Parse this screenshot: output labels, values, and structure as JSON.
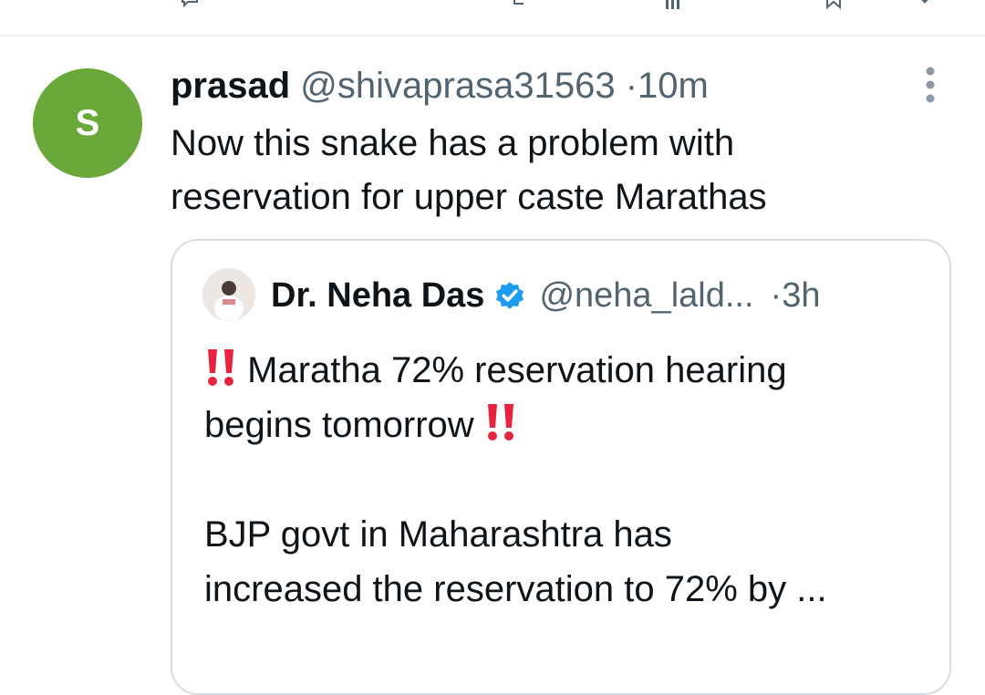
{
  "tweet": {
    "avatar_letter": "S",
    "avatar_color": "#6aa83a",
    "display_name": "prasad",
    "handle": "@shivaprasa31563",
    "separator": "·",
    "time": "10m",
    "text_line1": "Now this snake has a problem with",
    "text_line2": "reservation for upper caste Marathas"
  },
  "quote": {
    "display_name": "Dr. Neha Das",
    "handle": "@neha_lald...",
    "separator": "·",
    "time": "3h",
    "line1": "Maratha 72% reservation hearing",
    "line2": "begins tomorrow",
    "line3": "BJP govt in Maharashtra has",
    "line4": "increased the reservation to 72% by ..."
  },
  "icons": {
    "top": [
      "reply-icon",
      "retweet-icon",
      "views-icon",
      "bookmark-icon",
      "share-icon"
    ],
    "more": "more-vertical-icon",
    "verified": "verified-badge-icon",
    "emphasis": "double-exclamation-icon"
  },
  "colors": {
    "verified_blue": "#1d9bf0",
    "exclamation_red": "#e8233d",
    "secondary_text": "#536471"
  }
}
